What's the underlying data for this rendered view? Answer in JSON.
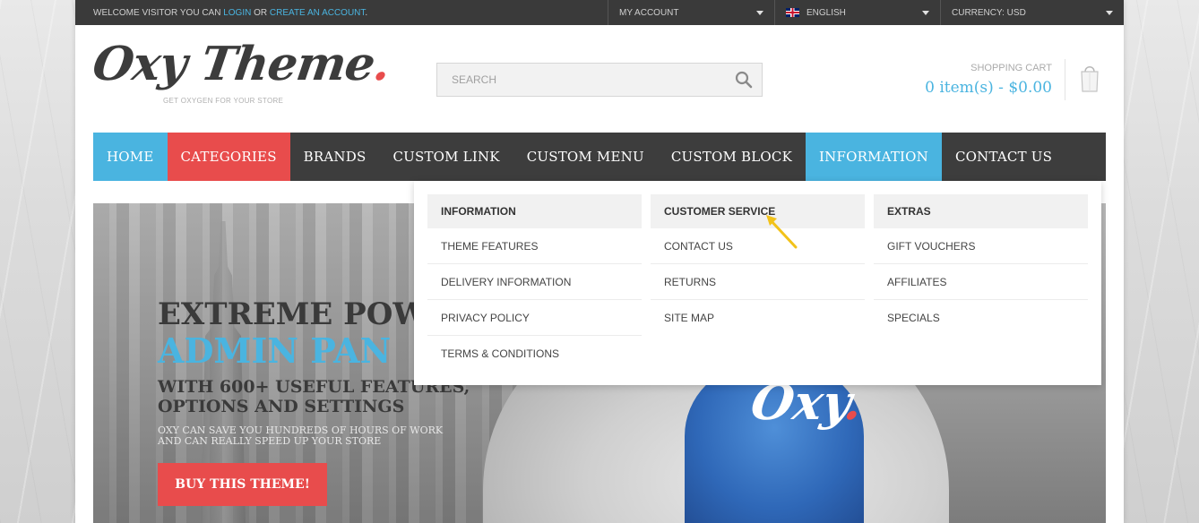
{
  "topbar": {
    "welcome_prefix": "WELCOME VISITOR YOU CAN",
    "login_label": "LOGIN",
    "or_text": "OR",
    "create_account_label": "CREATE AN ACCOUNT",
    "period": ".",
    "my_account_label": "MY ACCOUNT",
    "language_label": "ENGLISH",
    "currency_label": "CURRENCY: USD"
  },
  "header": {
    "logo_text": "Oxy Theme",
    "logo_dot": ".",
    "tagline": "GET OXYGEN FOR YOUR STORE",
    "search_placeholder": "SEARCH",
    "cart_label": "SHOPPING CART",
    "cart_total": "0 item(s) - $0.00"
  },
  "nav": {
    "items": [
      {
        "label": "HOME"
      },
      {
        "label": "CATEGORIES"
      },
      {
        "label": "BRANDS"
      },
      {
        "label": "CUSTOM LINK"
      },
      {
        "label": "CUSTOM MENU"
      },
      {
        "label": "CUSTOM BLOCK"
      },
      {
        "label": "INFORMATION"
      },
      {
        "label": "CONTACT US"
      }
    ]
  },
  "dropdown": {
    "columns": [
      {
        "heading": "INFORMATION",
        "links": [
          "THEME FEATURES",
          "DELIVERY INFORMATION",
          "PRIVACY POLICY",
          "TERMS & CONDITIONS"
        ]
      },
      {
        "heading": "CUSTOMER SERVICE",
        "links": [
          "CONTACT US",
          "RETURNS",
          "SITE MAP"
        ]
      },
      {
        "heading": "EXTRAS",
        "links": [
          "GIFT VOUCHERS",
          "AFFILIATES",
          "SPECIALS"
        ]
      }
    ]
  },
  "banner": {
    "title_line1": "EXTREME POW",
    "title_line2": "ADMIN PAN",
    "subtitle_line1": "WITH 600+ USEFUL FEATURES,",
    "subtitle_line2": "OPTIONS AND SETTINGS",
    "small_line1": "OXY CAN SAVE YOU HUNDREDS OF HOURS OF WORK",
    "small_line2": "AND CAN REALLY SPEED UP YOUR STORE",
    "cta_label": "BUY THIS THEME!",
    "chest_logo": "Oxy",
    "chest_dot": "."
  },
  "colors": {
    "accent_blue": "#4ab4e0",
    "accent_red": "#e84c4c",
    "nav_dark": "#3d3d3d",
    "topbar_dark": "#3a3a3a"
  },
  "icons": {
    "search": "search-icon",
    "cart": "shopping-bag-icon",
    "caret": "chevron-down-icon",
    "flag": "uk-flag-icon",
    "pointer": "arrow-pointer-icon"
  }
}
